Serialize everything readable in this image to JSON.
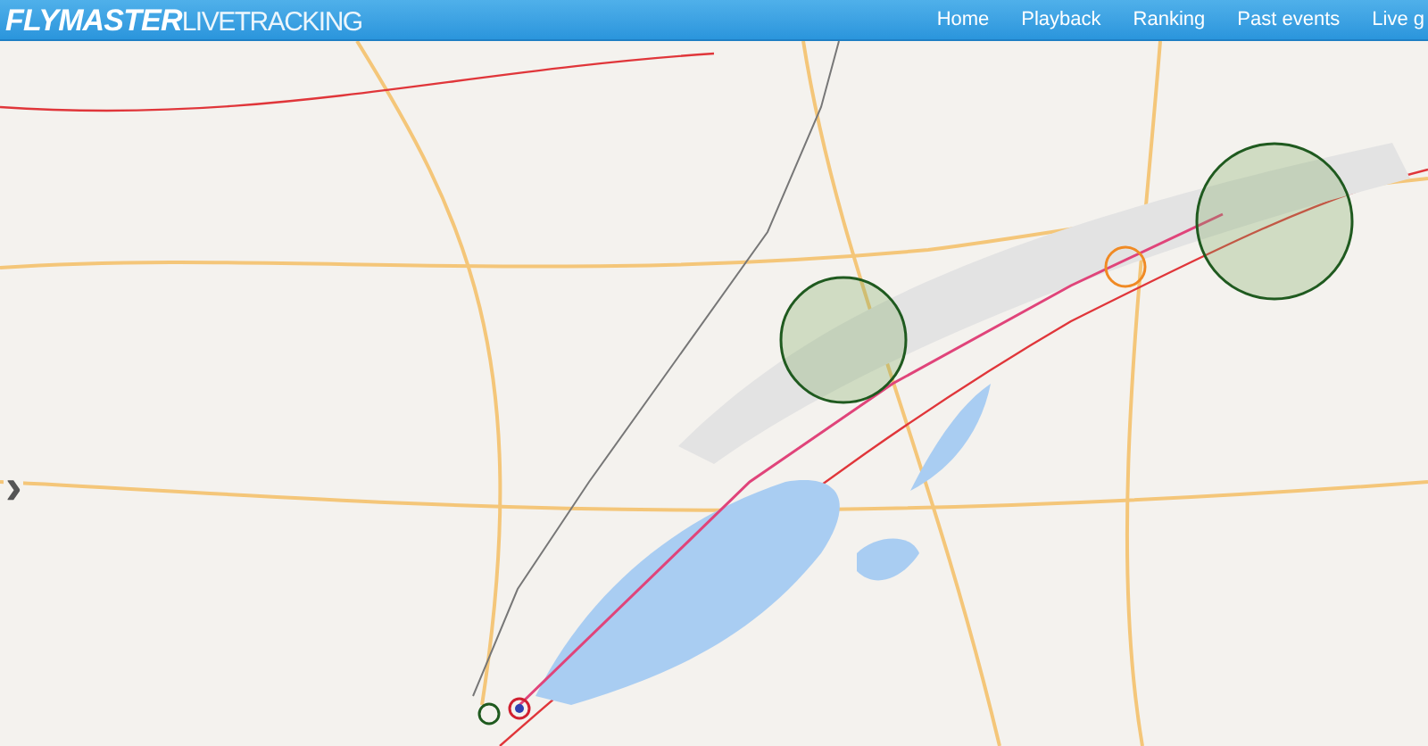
{
  "navbar": {
    "logo": {
      "brand": "FLYMASTER",
      "product": "LIVETRACKING"
    },
    "links": [
      {
        "label": "Home"
      },
      {
        "label": "Playback"
      },
      {
        "label": "Ranking"
      },
      {
        "label": "Past events"
      },
      {
        "label": "Live g"
      }
    ]
  },
  "map": {
    "side_panel_toggle": "›"
  }
}
